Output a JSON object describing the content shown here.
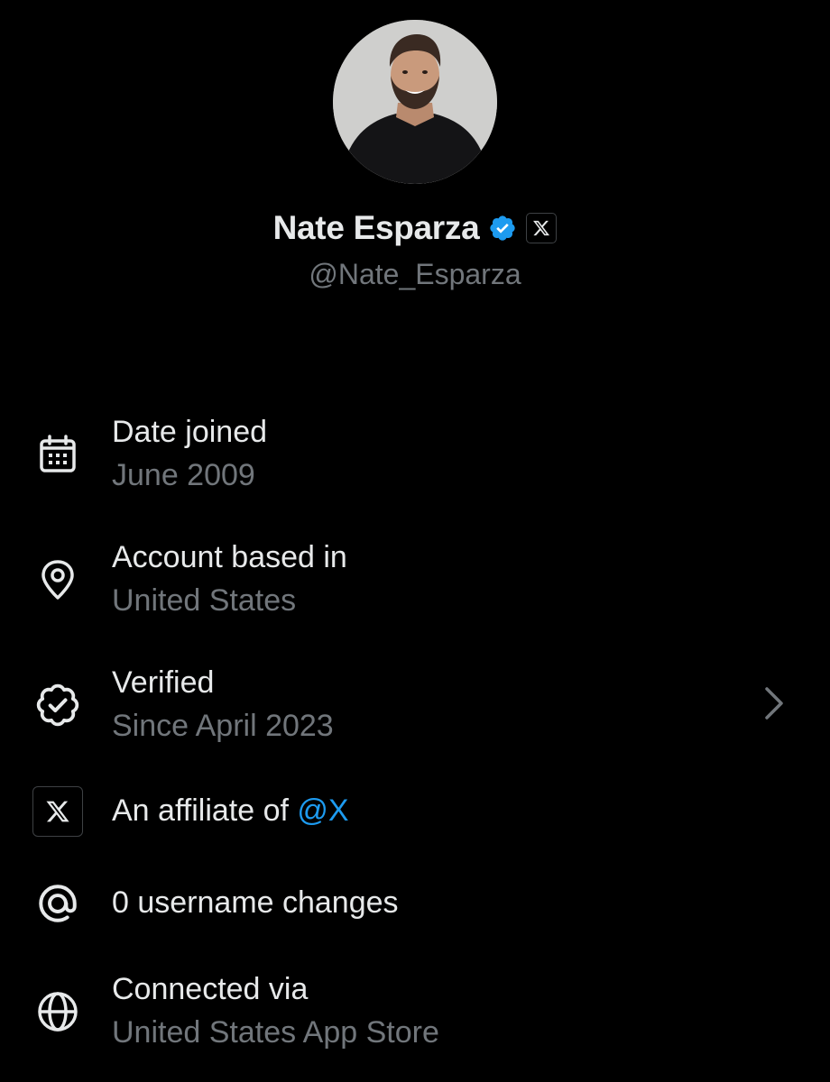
{
  "profile": {
    "name": "Nate Esparza",
    "handle": "@Nate_Esparza",
    "verified_badge_icon": "verified-badge-icon",
    "affiliate_badge_icon": "x-logo-icon",
    "accent_color": "#1d9bf0"
  },
  "details": {
    "date_joined": {
      "icon": "calendar-icon",
      "title": "Date joined",
      "value": "June 2009"
    },
    "account_based_in": {
      "icon": "location-pin-icon",
      "title": "Account based in",
      "value": "United States"
    },
    "verified": {
      "icon": "verified-outline-icon",
      "title": "Verified",
      "value": "Since April 2023",
      "chevron_icon": "chevron-right-icon"
    },
    "affiliate": {
      "icon": "x-logo-icon",
      "prefix": "An affiliate of ",
      "link": "@X"
    },
    "username_changes": {
      "icon": "at-sign-icon",
      "title": "0 username changes"
    },
    "connected_via": {
      "icon": "globe-icon",
      "title": "Connected via",
      "value": "United States App Store"
    }
  }
}
